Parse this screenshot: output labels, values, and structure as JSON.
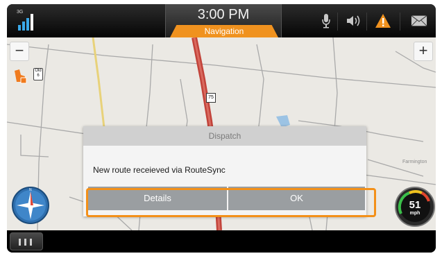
{
  "status_bar": {
    "network_label": "3G",
    "time": "3:00 PM",
    "mode_tab": "Navigation",
    "icons": [
      "signal-icon",
      "mic-icon",
      "volume-icon",
      "warning-icon",
      "mail-icon"
    ],
    "accent_color": "#f0921f"
  },
  "map": {
    "zoom_out_label": "−",
    "zoom_in_label": "+",
    "route_shield": "75",
    "old_road_sign": "Old\n6",
    "place_label": "Farmington"
  },
  "speed": {
    "value": "51",
    "unit": "mph"
  },
  "dialog": {
    "title": "Dispatch",
    "message": "New route receieved via RouteSync",
    "details_button": "Details",
    "ok_button": "OK",
    "highlight_color": "#f39019"
  }
}
